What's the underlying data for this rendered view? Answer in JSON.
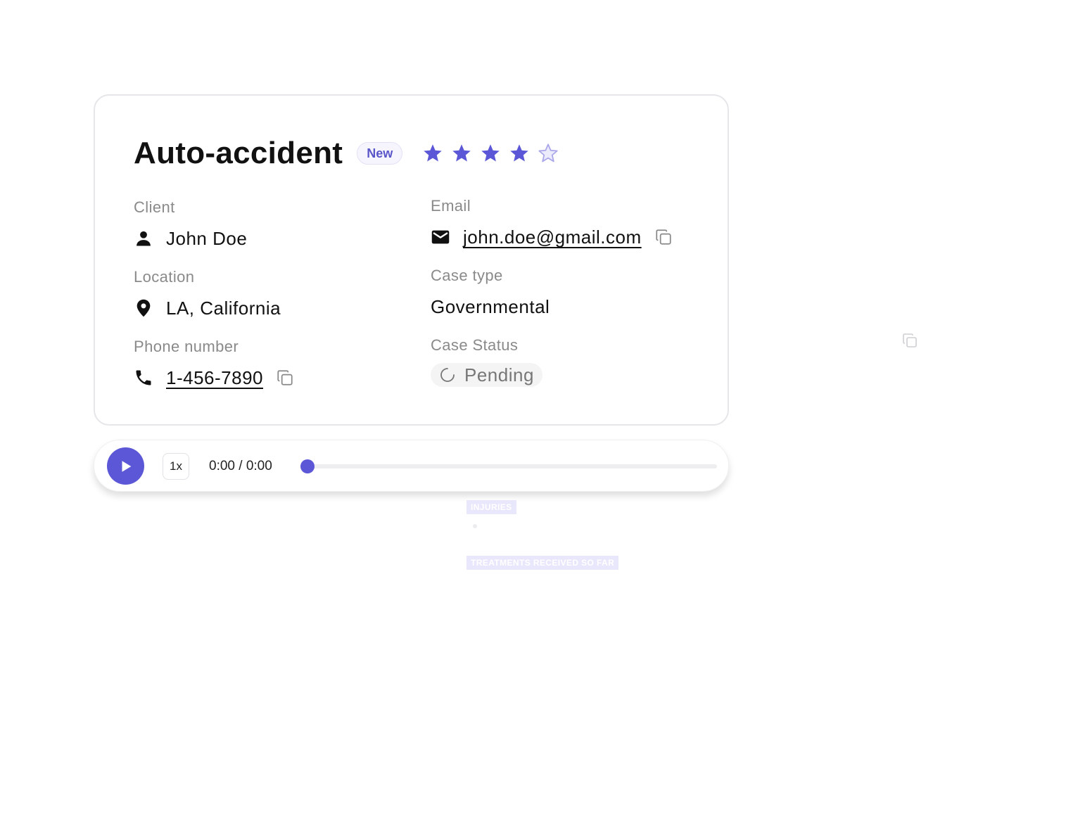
{
  "case": {
    "title": "Auto-accident",
    "badge": "New",
    "rating": {
      "value": 4,
      "max": 5
    },
    "accent_color": "#5b57d6"
  },
  "fields": {
    "client": {
      "label": "Client",
      "value": "John Doe",
      "icon": "person-icon"
    },
    "email": {
      "label": "Email",
      "value": "john.doe@gmail.com",
      "icon": "mail-icon"
    },
    "location": {
      "label": "Location",
      "value": "LA, California",
      "icon": "location-pin-icon"
    },
    "case_type": {
      "label": "Case type",
      "value": "Governmental"
    },
    "phone": {
      "label": "Phone number",
      "value": "1-456-7890",
      "icon": "phone-icon"
    },
    "case_status": {
      "label": "Case Status",
      "value": "Pending",
      "icon": "spinner-icon"
    }
  },
  "player": {
    "speed": "1x",
    "time": "0:00 / 0:00",
    "progress": 0
  },
  "background_tags": {
    "injuries": "INJURIES",
    "treatments": "TREATMENTS RECEIVED SO FAR"
  }
}
